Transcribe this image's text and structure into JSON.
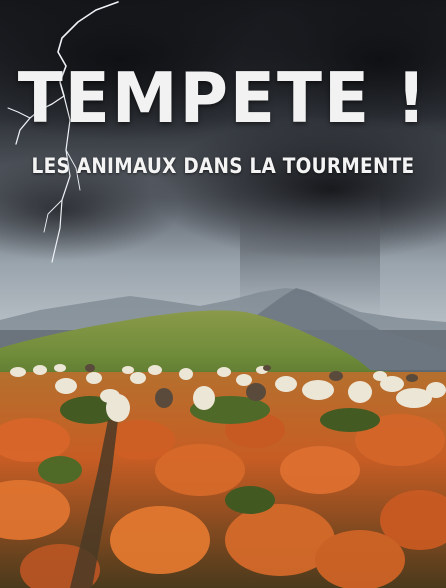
{
  "poster": {
    "title": "TEMPETE !",
    "subtitle": "LES ANIMAUX DANS LA TOURMENTE"
  },
  "scene": {
    "elements": [
      "storm-sky",
      "lightning-bolt",
      "rain-curtain",
      "distant-mountains",
      "green-hill",
      "sheep-flock",
      "orange-grass-meadow",
      "dirt-path"
    ]
  },
  "colors": {
    "sky_dark": "#1c1e22",
    "sky_mid": "#5b6068",
    "haze": "#9aa4ad",
    "hill_green": "#6e8a3e",
    "grass_orange": "#d9662a",
    "grass_green": "#3d5a22",
    "title_text": "#f2f2f2"
  }
}
